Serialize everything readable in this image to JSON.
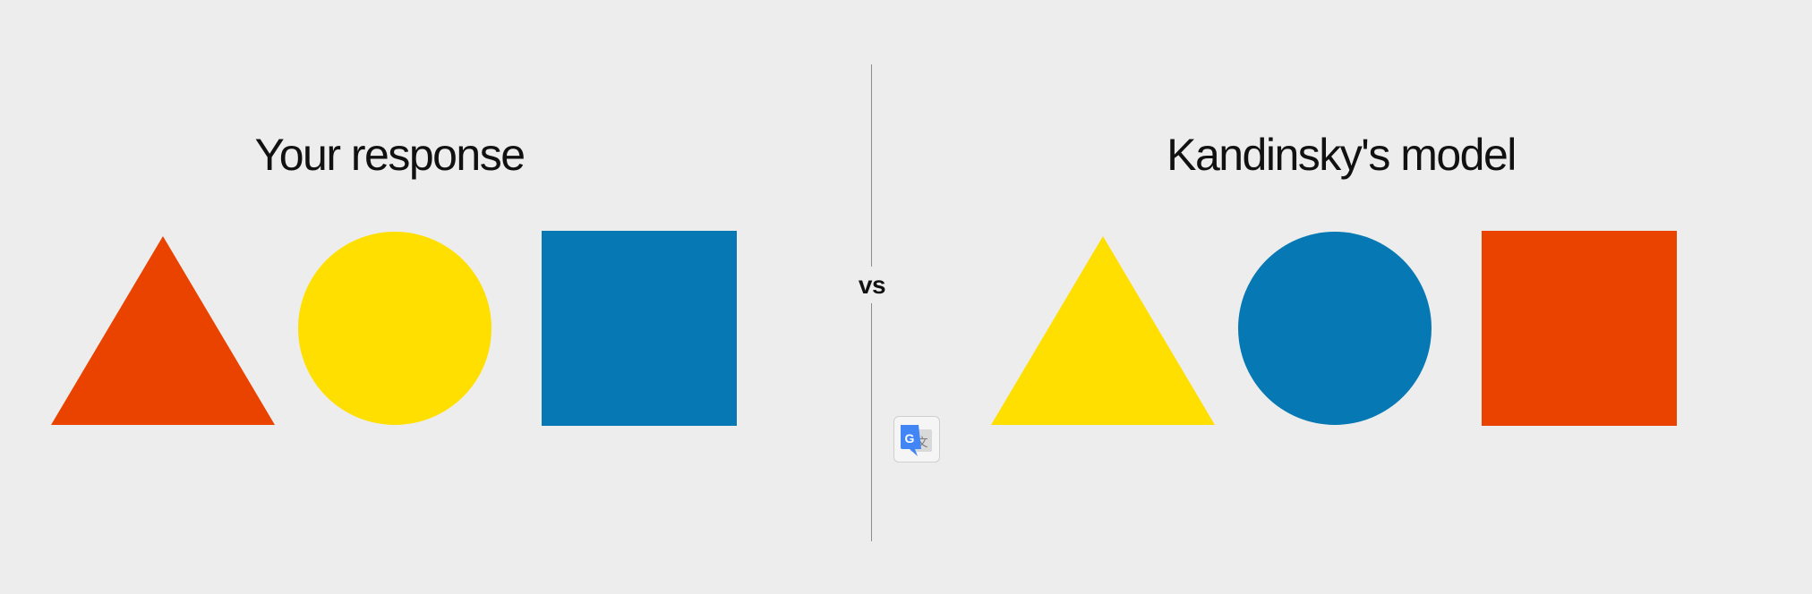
{
  "left_panel": {
    "title": "Your response",
    "shapes": [
      {
        "shape": "triangle",
        "color": "#ea4300"
      },
      {
        "shape": "circle",
        "color": "#ffdf00"
      },
      {
        "shape": "square",
        "color": "#0679b5"
      }
    ]
  },
  "right_panel": {
    "title": "Kandinsky's model",
    "shapes": [
      {
        "shape": "triangle",
        "color": "#ffdf00"
      },
      {
        "shape": "circle",
        "color": "#0679b5"
      },
      {
        "shape": "square",
        "color": "#ea4300"
      }
    ]
  },
  "divider": {
    "label": "vs"
  },
  "translate_widget": {
    "icon": "google-translate-icon"
  }
}
